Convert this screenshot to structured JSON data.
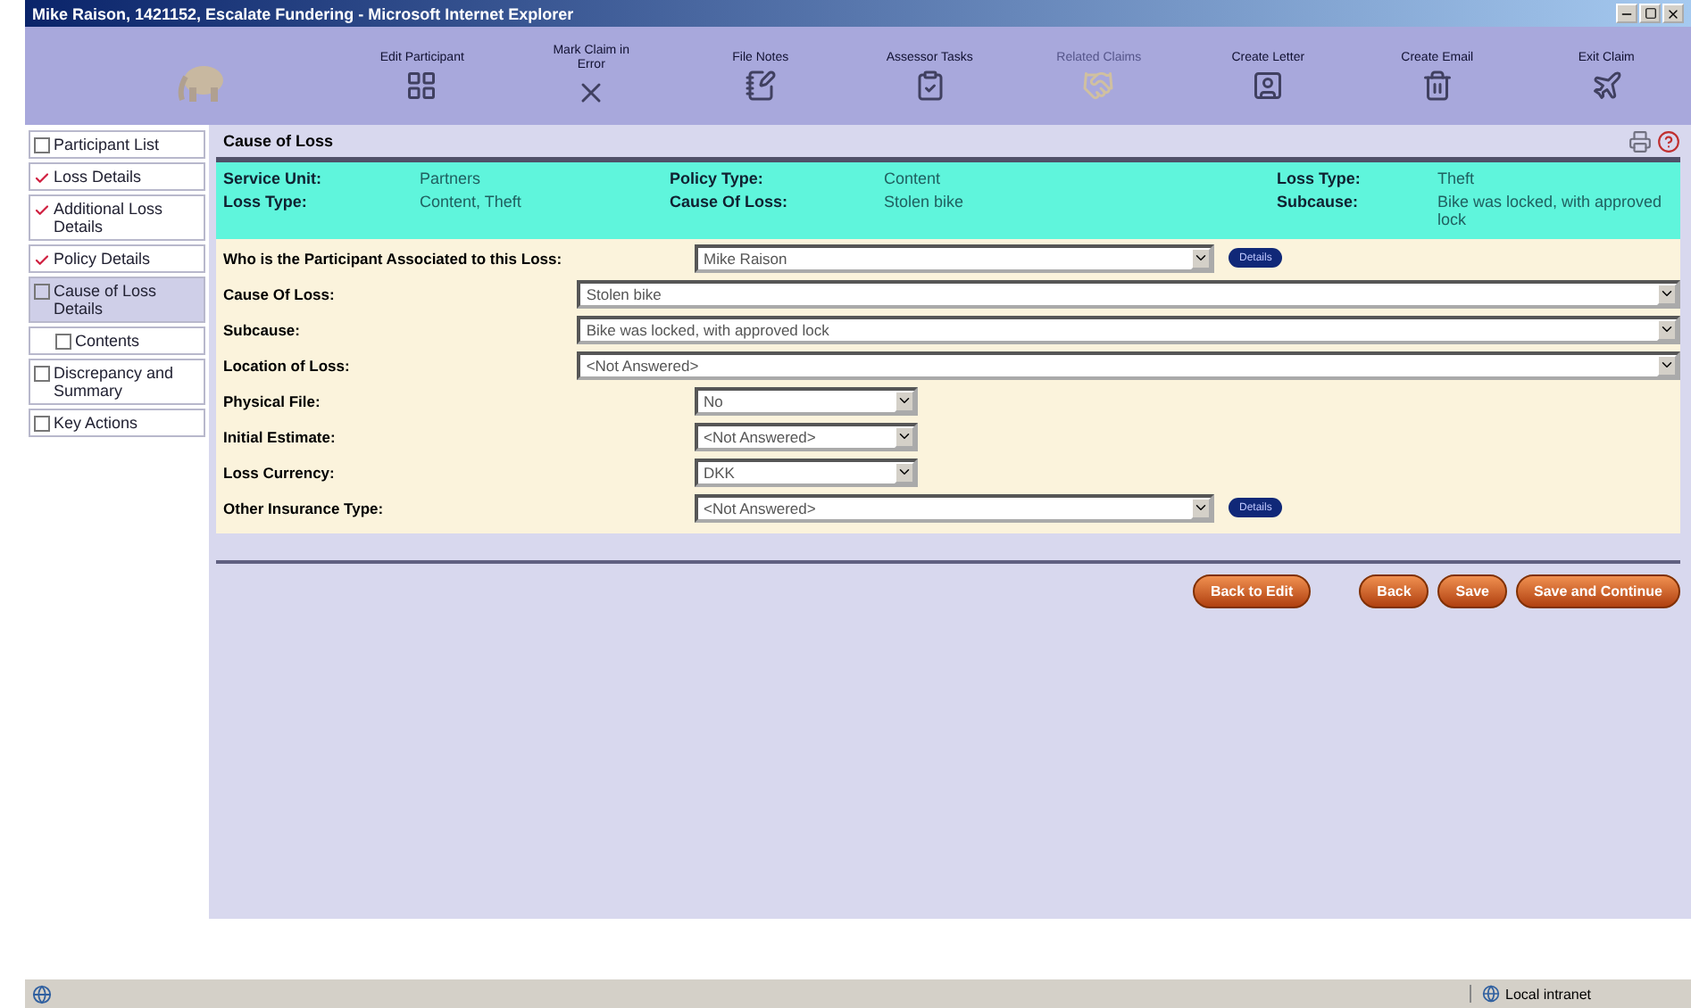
{
  "window": {
    "title": "Mike Raison, 1421152, Escalate Fundering - Microsoft Internet Explorer"
  },
  "toolbar": [
    {
      "label": "Edit Participant",
      "disabled": false
    },
    {
      "label": "Mark Claim in Error",
      "disabled": false
    },
    {
      "label": "File Notes",
      "disabled": false
    },
    {
      "label": "Assessor Tasks",
      "disabled": false
    },
    {
      "label": "Related Claims",
      "disabled": true
    },
    {
      "label": "Create Letter",
      "disabled": false
    },
    {
      "label": "Create Email",
      "disabled": false
    },
    {
      "label": "Exit Claim",
      "disabled": false
    }
  ],
  "sidebar": {
    "items": [
      {
        "label": "Participant List",
        "checked": false,
        "selected": false
      },
      {
        "label": "Loss Details",
        "checked": true,
        "selected": false
      },
      {
        "label": "Additional Loss Details",
        "checked": true,
        "selected": false
      },
      {
        "label": "Policy Details",
        "checked": true,
        "selected": false
      },
      {
        "label": "Cause of Loss Details",
        "checked": false,
        "selected": true,
        "children": [
          {
            "label": "Contents",
            "checked": false,
            "selected": false
          }
        ]
      },
      {
        "label": "Discrepancy and Summary",
        "checked": false,
        "selected": false
      },
      {
        "label": "Key Actions",
        "checked": false,
        "selected": false
      }
    ]
  },
  "page": {
    "title": "Cause of Loss"
  },
  "summary": [
    [
      {
        "label": "Service Unit:",
        "value": "Partners"
      },
      {
        "label": "Policy Type:",
        "value": "Content"
      },
      {
        "label": "Loss Type:",
        "value": "Theft"
      }
    ],
    [
      {
        "label": "Loss Type:",
        "value": "Content, Theft"
      },
      {
        "label": "Cause Of Loss:",
        "value": "Stolen bike"
      },
      {
        "label": "Subcause:",
        "value": "Bike was locked, with approved lock"
      }
    ]
  ],
  "form": [
    {
      "label": "Who is the Participant Associated to this Loss:",
      "value": "Mike Raison",
      "kind": "medium",
      "button": "Details"
    },
    {
      "label": "Cause Of Loss:",
      "value": "Stolen bike",
      "kind": "wide"
    },
    {
      "label": "Subcause:",
      "value": "Bike was locked, with approved lock",
      "kind": "wide"
    },
    {
      "label": "Location of Loss:",
      "value": "<Not Answered>",
      "kind": "wide"
    },
    {
      "label": "Physical File:",
      "value": "No",
      "kind": "short"
    },
    {
      "label": "Initial Estimate:",
      "value": "<Not Answered>",
      "kind": "short"
    },
    {
      "label": "Loss Currency:",
      "value": "DKK",
      "kind": "short"
    },
    {
      "label": "Other Insurance Type:",
      "value": "<Not Answered>",
      "kind": "medium",
      "button": "Details"
    }
  ],
  "actions": [
    {
      "label": "Back to Edit"
    },
    {
      "label": "Back"
    },
    {
      "label": "Save"
    },
    {
      "label": "Save and Continue"
    }
  ],
  "status_bar": {
    "zone": "Local intranet"
  }
}
